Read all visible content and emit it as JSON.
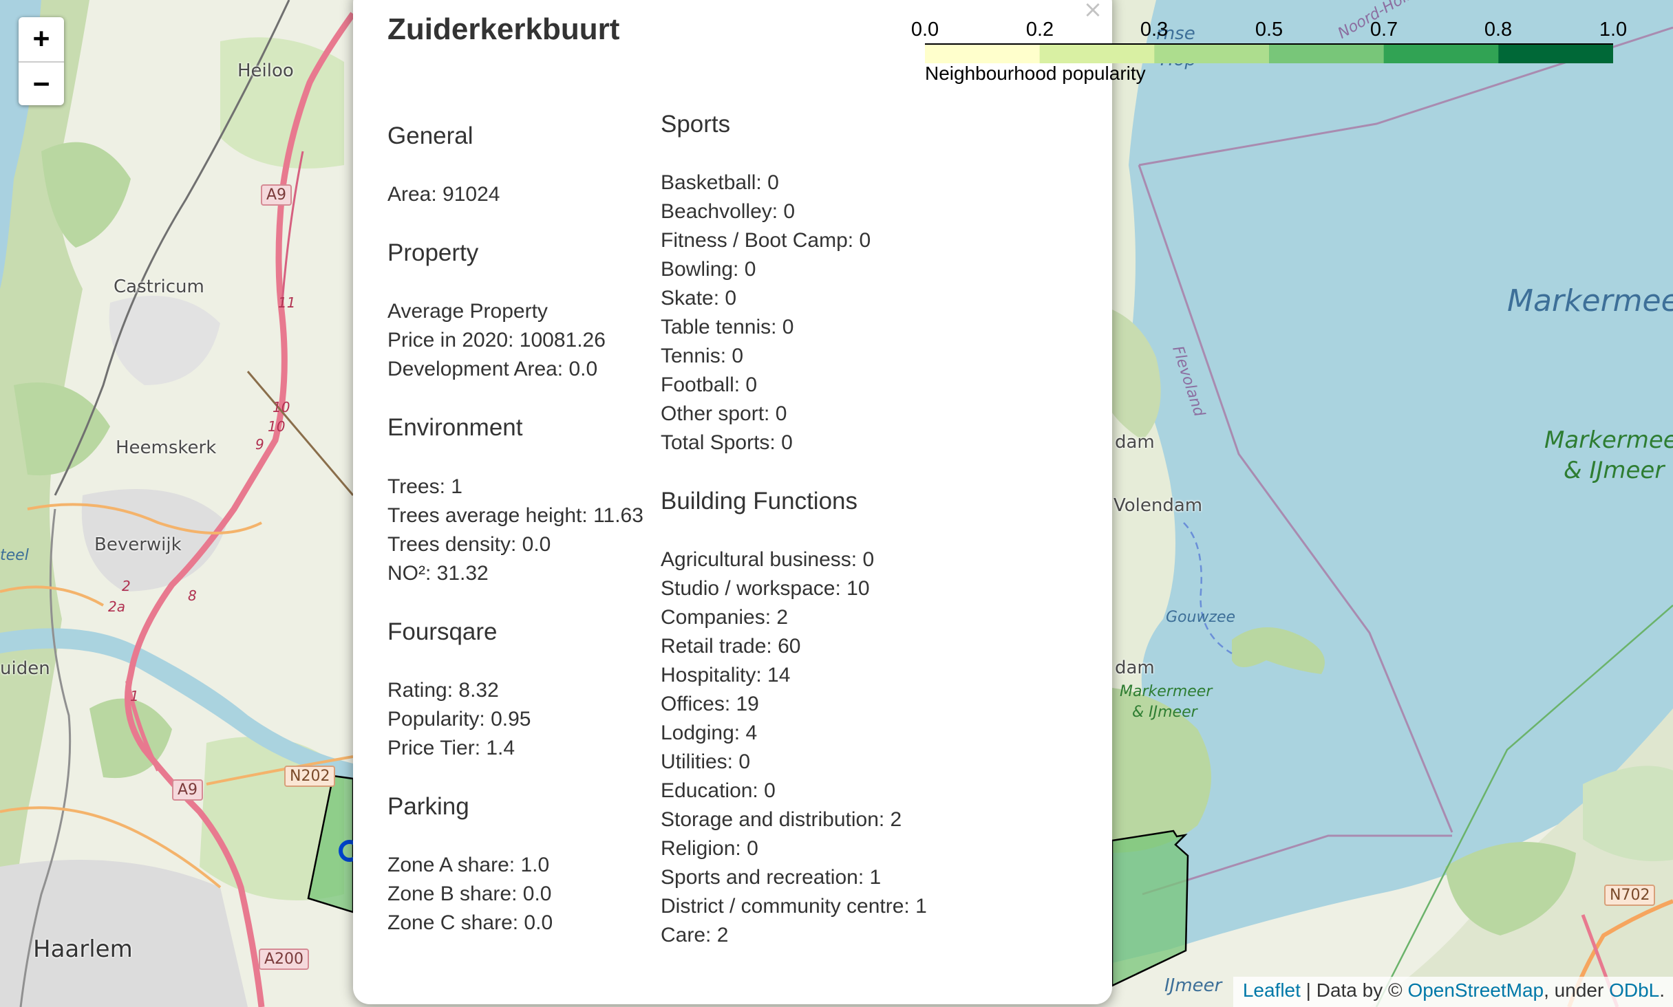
{
  "map": {
    "labels": {
      "heiloo": "Heiloo",
      "castricum": "Castricum",
      "heemskerk": "Heemskerk",
      "beverwijk": "Beverwijk",
      "ijmuiden": "uiden",
      "haarlem": "Haarlem",
      "teel": "teel",
      "markermeer": "Markermeer",
      "markermeer_ijmeer_1": "Markermeer",
      "markermeer_ijmeer_2": "& IJmeer",
      "volendam": "Volendam",
      "edam_1": "dam",
      "edam_2": "dam",
      "gouwzee": "Gouwzee",
      "flevoland": "Flevoland",
      "marker_small_1": "Markermeer",
      "marker_small_2": "& IJmeer",
      "ijmeer": "IJmeer",
      "noord_holland": "Noord-Holl",
      "hornse_hop_1": "rnse",
      "hornse_hop_2": "Hop"
    },
    "roads": {
      "a9_top": "A9",
      "a9_bottom": "A9",
      "n202": "N202",
      "a200": "A200",
      "n702": "N702"
    },
    "exits": [
      "11",
      "10",
      "10",
      "9",
      "2",
      "2a",
      "8",
      "1"
    ]
  },
  "zoom": {
    "in_label": "+",
    "out_label": "−"
  },
  "popup": {
    "close_label": "×",
    "title": "Zuiderkerkbuurt",
    "general": {
      "heading": "General",
      "area": "Area: 91024"
    },
    "property": {
      "heading": "Property",
      "line1": "Average Property",
      "line2": "Price in 2020: 10081.26",
      "line3": "Development Area: 0.0"
    },
    "environment": {
      "heading": "Environment",
      "trees": "Trees: 1",
      "trees_height": "Trees average height: 11.63",
      "trees_density": "Trees density: 0.0",
      "no2": "NO²: 31.32"
    },
    "foursquare": {
      "heading": "Foursqare",
      "rating": "Rating: 8.32",
      "popularity": "Popularity: 0.95",
      "price_tier": "Price Tier: 1.4"
    },
    "parking": {
      "heading": "Parking",
      "zone_a": "Zone A share: 1.0",
      "zone_b": "Zone B share: 0.0",
      "zone_c": "Zone C share: 0.0"
    },
    "sports": {
      "heading": "Sports",
      "items": [
        "Basketball: 0",
        "Beachvolley: 0",
        "Fitness / Boot Camp: 0",
        "Bowling: 0",
        "Skate: 0",
        "Table tennis: 0",
        "Tennis: 0",
        "Football: 0",
        "Other sport: 0",
        "Total Sports: 0"
      ]
    },
    "buildings": {
      "heading": "Building Functions",
      "items": [
        "Agricultural business: 0",
        "Studio / workspace: 10",
        "Companies: 2",
        "Retail trade: 60",
        "Hospitality: 14",
        "Offices: 19",
        "Lodging: 4",
        "Utilities: 0",
        "Education: 0",
        "Storage and distribution: 2",
        "Religion: 0",
        "Sports and recreation: 1",
        "District / community centre: 1",
        "Care: 2"
      ]
    }
  },
  "legend": {
    "ticks": [
      "0.0",
      "0.2",
      "0.3",
      "0.5",
      "0.7",
      "0.8",
      "1.0"
    ],
    "tick_values": [
      0.0,
      0.167,
      0.333,
      0.5,
      0.667,
      0.833,
      1.0
    ],
    "colors": [
      "#ffffcc",
      "#d9f0a3",
      "#addd8e",
      "#78c679",
      "#31a354",
      "#006837"
    ],
    "caption": "Neighbourhood popularity"
  },
  "attribution": {
    "leaflet": "Leaflet",
    "sep": " | Data by © ",
    "osm": "OpenStreetMap",
    "under": ", under ",
    "odbl": "ODbL",
    "end": "."
  }
}
